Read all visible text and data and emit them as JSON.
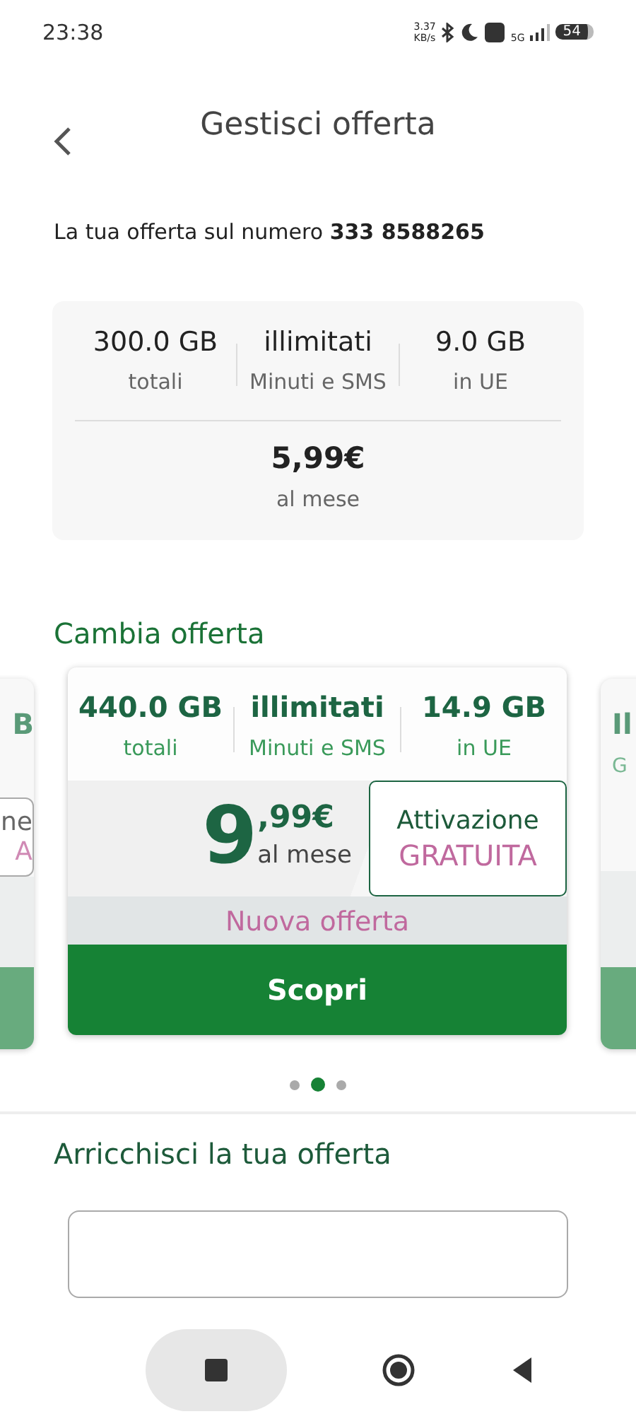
{
  "status_bar": {
    "time": "23:38",
    "net_speed": [
      "3.37",
      "KB/s"
    ],
    "network": "5G",
    "battery": "54"
  },
  "header": {
    "title": "Gestisci offerta"
  },
  "offer_line": "La tua offerta sul numero **333 8588265**",
  "current_plan": {
    "stats": [
      {
        "value": "300.0 GB",
        "label": "totali"
      },
      {
        "value": "illimitati",
        "label": "Minuti e SMS"
      },
      {
        "value": "9.0 GB",
        "label": "in UE"
      }
    ],
    "price": "5,99€",
    "price_label": "al mese"
  },
  "change_section": {
    "title": "Cambia offerta"
  },
  "carousel": {
    "prev_peek": [
      "B",
      "ne",
      "A"
    ],
    "card": {
      "stats": [
        {
          "value": "440.0 GB",
          "label": "totali"
        },
        {
          "value": "illimitati",
          "label": "Minuti e SMS"
        },
        {
          "value": "14.9 GB",
          "label": "in UE"
        }
      ],
      "price_int": "9",
      "price_dec": ",99€",
      "price_label": "al mese",
      "activation": "Attivazione",
      "activation_badge": "GRATUITA",
      "new_label": "Nuova offerta",
      "button": "Scopri"
    },
    "next_peek": [
      "Il",
      "G"
    ],
    "dots": [
      {
        "selected": false
      },
      {
        "selected": true
      },
      {
        "selected": false
      }
    ]
  },
  "enrich_section": {
    "title": "Arricchisci la tua offerta"
  }
}
